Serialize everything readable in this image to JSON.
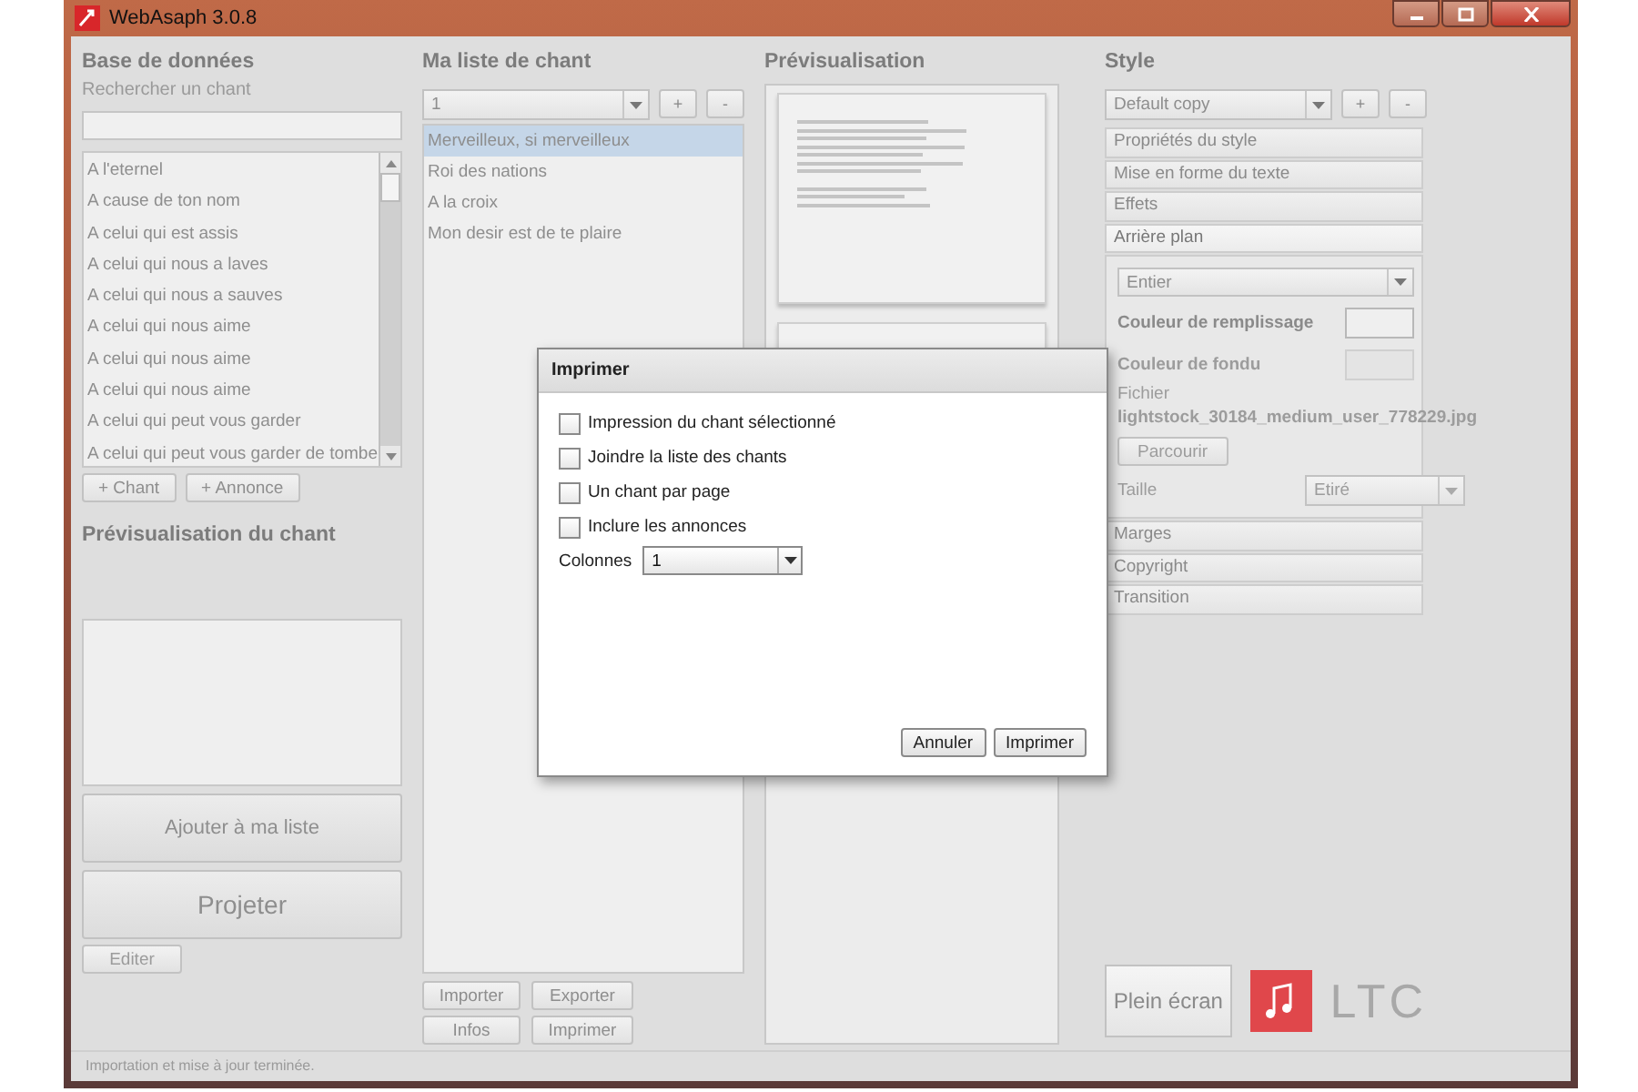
{
  "window": {
    "title": "WebAsaph 3.0.8"
  },
  "database": {
    "title": "Base de données",
    "search_label": "Rechercher un chant",
    "songs": [
      "A l'eternel",
      "A cause de ton nom",
      "A celui qui est assis",
      "A celui qui nous a laves",
      "A celui qui nous a sauves",
      "A celui qui nous aime",
      "A celui qui nous aime",
      "A celui qui nous aime",
      "A celui qui peut vous garder",
      "A celui qui peut vous garder de tombe"
    ],
    "buttons": [
      "+ Chant",
      "+ Annonce"
    ]
  },
  "song_preview": {
    "title": "Prévisualisation du chant",
    "add_button": "Ajouter à ma liste",
    "project_button": "Projeter",
    "edit_button": {
      "label": "Editer",
      "disabled": true
    }
  },
  "my_list": {
    "title": "Ma liste de chant",
    "list_select": "1",
    "add": "+",
    "remove": "-",
    "items": [
      {
        "label": "Merveilleux, si merveilleux",
        "selected": true
      },
      {
        "label": "Roi des nations",
        "selected": false
      },
      {
        "label": "A la croix",
        "selected": false
      },
      {
        "label": "Mon desir est de te plaire",
        "selected": false
      }
    ],
    "buttons": [
      "Importer",
      "Exporter",
      "Infos",
      "Imprimer"
    ]
  },
  "preview": {
    "title": "Prévisualisation"
  },
  "style": {
    "title": "Style",
    "style_select": "Default copy",
    "add": "+",
    "remove": "-",
    "sections": [
      {
        "label": "Propriétés du style",
        "expanded": false
      },
      {
        "label": "Mise en forme du texte",
        "expanded": false
      },
      {
        "label": "Effets",
        "expanded": false
      },
      {
        "label": "Arrière plan",
        "expanded": true
      },
      {
        "label": "Marges",
        "expanded": false
      },
      {
        "label": "Copyright",
        "expanded": false
      },
      {
        "label": "Transition",
        "expanded": false
      }
    ],
    "background": {
      "mode": "Entier",
      "fill_color": {
        "label": "Couleur de remplissage",
        "disabled": false
      },
      "fade_color": {
        "label": "Couleur de fondu",
        "disabled": true
      },
      "file_label": "Fichier",
      "file_name": "lightstock_30184_medium_user_778229.jpg",
      "browse": {
        "label": "Parcourir",
        "disabled": true
      },
      "size_label": "Taille",
      "size": {
        "value": "Etiré",
        "disabled": true
      }
    },
    "fullscreen_button": "Plein écran",
    "logo_text": "LTC"
  },
  "status_bar": "Importation et mise à jour terminée.",
  "dialog": {
    "title": "Imprimer",
    "options": [
      {
        "label": "Impression du chant sélectionné",
        "checked": false
      },
      {
        "label": "Joindre la liste des chants",
        "checked": false
      },
      {
        "label": "Un chant par page",
        "checked": false
      },
      {
        "label": "Inclure les annonces",
        "checked": false
      }
    ],
    "columns_label": "Colonnes",
    "columns": "1",
    "buttons": [
      "Annuler",
      "Imprimer"
    ]
  }
}
